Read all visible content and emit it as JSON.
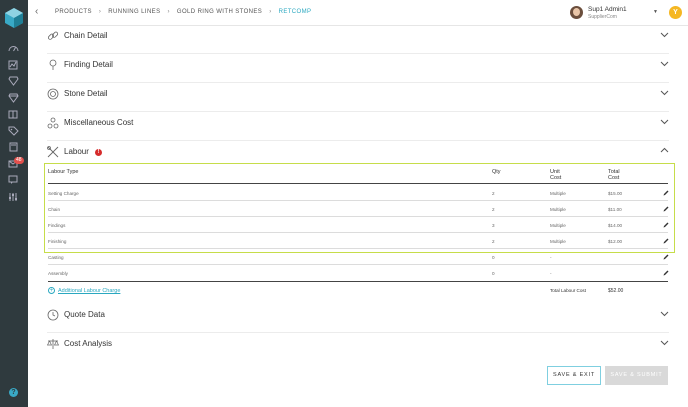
{
  "breadcrumbs": [
    {
      "label": "PRODUCTS"
    },
    {
      "label": "RUNNING LINES"
    },
    {
      "label": "GOLD RING WITH STONES"
    },
    {
      "label": "RETCOMP"
    }
  ],
  "user": {
    "name": "Sup1 Admin1",
    "company": "SupplierCom",
    "notification_initial": "Y"
  },
  "sidebar": {
    "badge_count": "48",
    "help_label": "?"
  },
  "sections": {
    "chain": "Chain Detail",
    "finding": "Finding Detail",
    "stone": "Stone Detail",
    "misc": "Miscellaneous Cost",
    "labour": "Labour",
    "quote": "Quote Data",
    "cost": "Cost Analysis"
  },
  "labour_alert": "!",
  "labour_table": {
    "headers": {
      "type": "Labour Type",
      "qty": "Qty",
      "unit_cost": "Unit\nCost",
      "total_cost": "Total\nCost"
    },
    "rows": [
      {
        "type": "Setting Charge",
        "qty": "2",
        "unit_cost": "Multiple",
        "total_cost": "$15.00"
      },
      {
        "type": "Chain",
        "qty": "2",
        "unit_cost": "Multiple",
        "total_cost": "$11.00"
      },
      {
        "type": "Findings",
        "qty": "3",
        "unit_cost": "Multiple",
        "total_cost": "$14.00"
      },
      {
        "type": "Finishing",
        "qty": "2",
        "unit_cost": "Multiple",
        "total_cost": "$12.00"
      },
      {
        "type": "Casting",
        "qty": "0",
        "unit_cost": "-",
        "total_cost": ""
      },
      {
        "type": "Assembly",
        "qty": "0",
        "unit_cost": "-",
        "total_cost": ""
      }
    ],
    "add_link": "Additional Labour Charge",
    "total_label": "Total Labour Cost",
    "total_value": "$52.00"
  },
  "buttons": {
    "save_exit": "SAVE & EXIT",
    "save_submit": "SAVE & SUBMIT"
  },
  "colors": {
    "sidebar": "#2f3a3e",
    "accent": "#2aa8c0",
    "highlight": "#c6dd4a",
    "alert": "#d62c2c",
    "notification": "#f5b722"
  }
}
